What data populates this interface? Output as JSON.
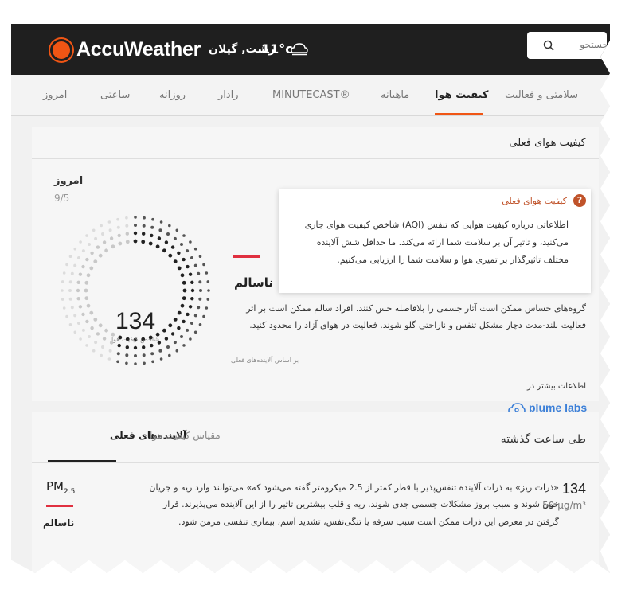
{
  "header": {
    "brand": "AccuWeather",
    "location": "رشت, گیلان",
    "temperature": "11°c",
    "weather_icon": "cloud-icon",
    "search_placeholder": "جستجو",
    "bg_color": "#1f1f1f",
    "accent_color": "#f05514"
  },
  "nav": {
    "items": [
      {
        "label": "سلامتی و فعالیت",
        "active": false
      },
      {
        "label": "کیفیت هوا",
        "active": true
      },
      {
        "label": "ماهیانه",
        "active": false
      },
      {
        "label": "MINUTECAST®",
        "active": false
      },
      {
        "label": "رادار",
        "active": false
      },
      {
        "label": "روزانه",
        "active": false
      },
      {
        "label": "ساعتی",
        "active": false
      },
      {
        "label": "امروز",
        "active": false
      }
    ]
  },
  "current": {
    "title": "کیفیت هوای فعلی",
    "day": "امروز",
    "date": "9/5",
    "aqi": "134",
    "aqi_label": "شاخص کیفیت هوا",
    "status": "ناسالم",
    "status_color": "#e03040",
    "description": "گروه‌های حساس ممکن است آثار جسمی را بلافاصله حس کنند. افراد سالم ممکن است بر اثر فعالیت بلند-مدت دچار مشکل تنفس و ناراحتی گلو شوند. فعالیت در هوای آزاد را محدود کنید.",
    "based_on": "بر اساس آلاینده‌های فعلی",
    "more_info": "اطلاعات بیشتر در",
    "partner": "plume labs",
    "partner_icon": "cloud-outline-icon",
    "tooltip": {
      "badge": "?",
      "title": "کیفیت هوای فعلی",
      "body": "اطلاعاتی درباره کیفیت هوایی که تنفس (AQI) شاخص کیفیت هوای جاری می‌کنید، و تاثیر آن بر سلامت شما ارائه می‌کند. ما حداقل شش آلاینده مختلف تاثیرگذار بر تمیزی هوا و سلامت شما را ارزیابی می‌کنیم."
    }
  },
  "pollutants": {
    "period_label": "طی ساعت گذشته",
    "tabs": [
      {
        "label": "آلاینده‌های فعلی",
        "active": true
      },
      {
        "label": "مقیاس کیفیت هوا",
        "active": false
      }
    ],
    "items": [
      {
        "name": "PM",
        "subscript": "2.5",
        "status": "ناسالم",
        "value": "134",
        "unit": "50 µg/m³",
        "description": "«ذرات ریز» به ذرات آلاینده تنفس‌پذیر با قطر کمتر از 2.5 میکرومتر گفته می‌شود که» می‌توانند وارد ریه و جریان خون شوند و سبب بروز مشکلات جسمی جدی شوند. ریه و قلب بیشترین تاثیر را از این آلاینده می‌پذیرند. قرار گرفتن در معرض این ذرات ممکن است سبب سرفه یا تنگی‌نفس، تشدید آسم، بیماری تنفسی مزمن شود."
      }
    ]
  }
}
